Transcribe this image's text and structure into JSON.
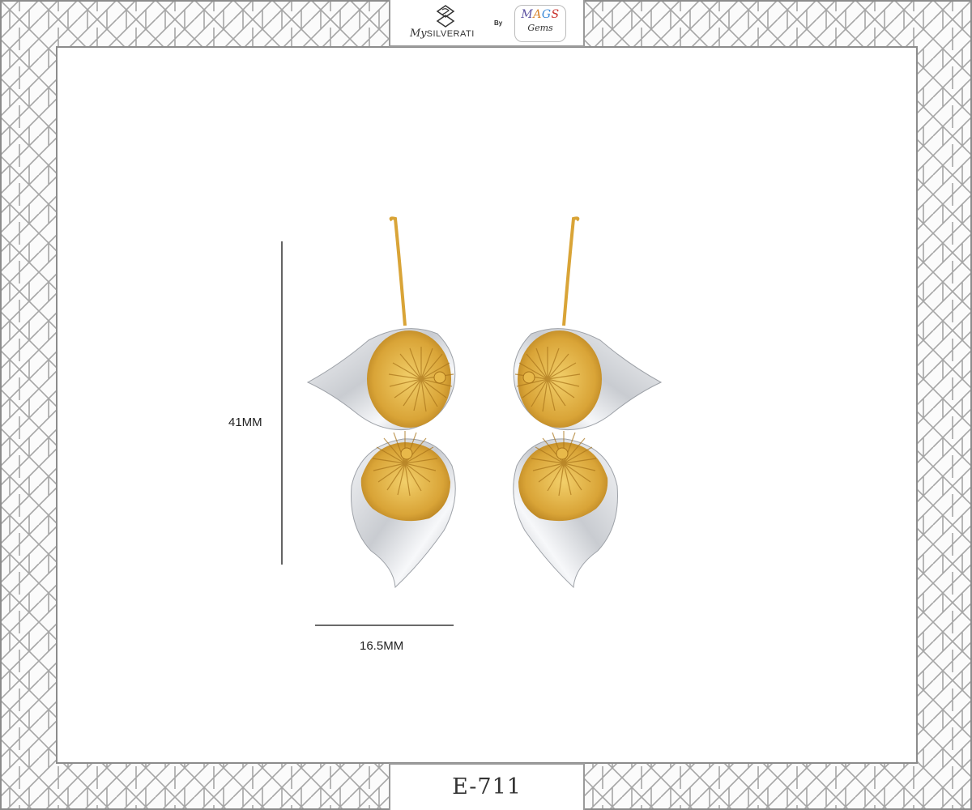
{
  "brand": {
    "name_prefix": "My",
    "name_main": "SILVERATI",
    "by": "By",
    "partner_line1_letters": [
      "M",
      "A",
      "G",
      "S"
    ],
    "partner_line2": "Gems",
    "mags_letter_colors": [
      "#5a4fa0",
      "#d8832a",
      "#3b8ad8",
      "#c9302c"
    ]
  },
  "product": {
    "code": "E-711",
    "height_label": "41MM",
    "width_label": "16.5MM"
  },
  "colors": {
    "frame_line": "#9a9a9a",
    "gold": "#d9a437",
    "silver": "#d6d8dc"
  }
}
